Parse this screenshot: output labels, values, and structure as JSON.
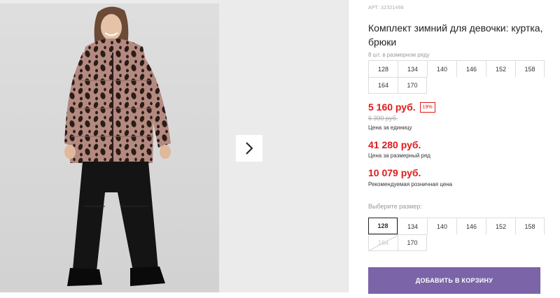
{
  "product": {
    "article_label": "АРТ:",
    "article_number": "32321498",
    "title": "Комплект зимний для девочки: куртка, брюки",
    "pack_caption": "8 шт. в размерном ряду",
    "pack_sizes": [
      "128",
      "134",
      "140",
      "146",
      "152",
      "158",
      "164",
      "170"
    ]
  },
  "pricing": {
    "unit_price": "5 160 руб.",
    "discount_badge": "19%",
    "old_price": "6 390 руб.",
    "unit_caption": "Цена за единицу",
    "pack_price": "41 280 руб.",
    "pack_caption": "Цена за размерный ряд",
    "rrp_price": "10 079 руб.",
    "rrp_caption": "Рекомендуемая розничная цена",
    "accent_color": "#e01a1a"
  },
  "size_selector": {
    "label": "Выберите размер:",
    "sizes": [
      "128",
      "134",
      "140",
      "146",
      "152",
      "158",
      "164",
      "170"
    ],
    "selected": "128",
    "unavailable": "164"
  },
  "actions": {
    "add_to_cart": "ДОБАВИТЬ В КОРЗИНУ",
    "button_color": "#7b64a8"
  },
  "gallery": {
    "next_icon": "chevron-right-icon",
    "photo_alt": "product-photo"
  }
}
